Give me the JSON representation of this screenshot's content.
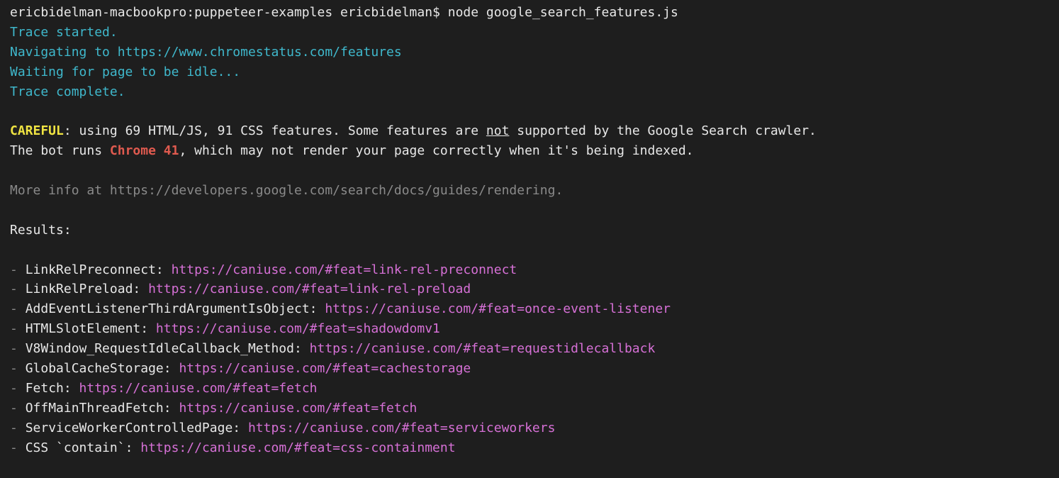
{
  "prompt": {
    "host": "ericbidelman-macbookpro",
    "sep1": ":",
    "dir": "puppeteer-examples",
    "user": "ericbidelman",
    "symbol": "$",
    "command": "node google_search_features.js"
  },
  "trace": {
    "started": "Trace started.",
    "navigating_prefix": "Navigating to ",
    "navigating_url": "https://www.chromestatus.com/features",
    "waiting": "Waiting for page to be idle...",
    "complete": "Trace complete."
  },
  "warning": {
    "label": "CAREFUL",
    "colon": ": ",
    "text1": "using 69 HTML/JS, 91 CSS features. Some features are ",
    "not": "not",
    "text2": " supported by the Google Search crawler.",
    "line2_pre": "The bot runs ",
    "chrome": "Chrome 41",
    "line2_post": ", which may not render your page correctly when it's being indexed."
  },
  "more_info": {
    "prefix": "More info at ",
    "url": "https://developers.google.com/search/docs/guides/rendering",
    "suffix": "."
  },
  "results_header": "Results:",
  "results": [
    {
      "name": "LinkRelPreconnect",
      "url": "https://caniuse.com/#feat=link-rel-preconnect"
    },
    {
      "name": "LinkRelPreload",
      "url": "https://caniuse.com/#feat=link-rel-preload"
    },
    {
      "name": "AddEventListenerThirdArgumentIsObject",
      "url": "https://caniuse.com/#feat=once-event-listener"
    },
    {
      "name": "HTMLSlotElement",
      "url": "https://caniuse.com/#feat=shadowdomv1"
    },
    {
      "name": "V8Window_RequestIdleCallback_Method",
      "url": "https://caniuse.com/#feat=requestidlecallback"
    },
    {
      "name": "GlobalCacheStorage",
      "url": "https://caniuse.com/#feat=cachestorage"
    },
    {
      "name": "Fetch",
      "url": "https://caniuse.com/#feat=fetch"
    },
    {
      "name": "OffMainThreadFetch",
      "url": "https://caniuse.com/#feat=fetch"
    },
    {
      "name": "ServiceWorkerControlledPage",
      "url": "https://caniuse.com/#feat=serviceworkers"
    },
    {
      "name": "CSS `contain`",
      "url": "https://caniuse.com/#feat=css-containment"
    }
  ]
}
